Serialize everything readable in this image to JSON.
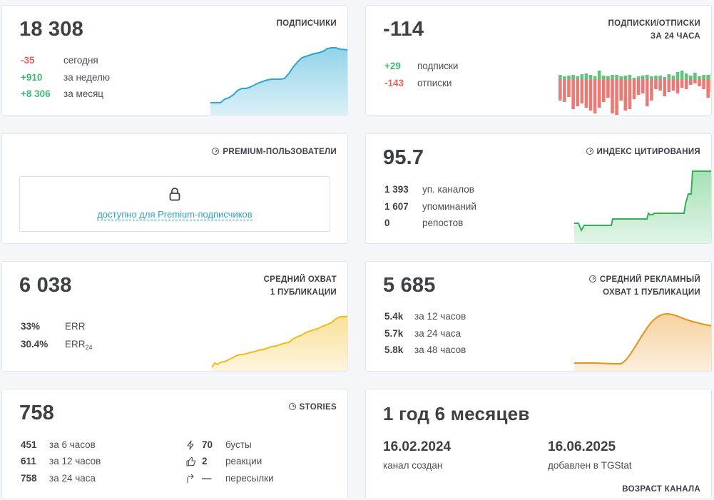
{
  "subscribers": {
    "value": "18 308",
    "title": "ПОДПИСЧИКИ",
    "rows": [
      {
        "value": "-35",
        "label": "сегодня"
      },
      {
        "value": "+910",
        "label": "за неделю"
      },
      {
        "value": "+8 306",
        "label": "за месяц"
      }
    ],
    "color": "#3bb0d6"
  },
  "subs_unsubs": {
    "value": "-114",
    "title": "ПОДПИСКИ/ОТПИСКИ",
    "title2": "ЗА 24 ЧАСА",
    "rows": [
      {
        "value": "+29",
        "label": "подписки"
      },
      {
        "value": "-143",
        "label": "отписки"
      }
    ],
    "pos_color": "#5ec57f",
    "neg_color": "#ea7a75"
  },
  "premium": {
    "title": "PREMIUM-ПОЛЬЗОВАТЕЛИ",
    "link": "доступно для Premium-подписчиков"
  },
  "citation": {
    "value": "95.7",
    "title": "ИНДЕКС ЦИТИРОВАНИЯ",
    "rows": [
      {
        "value": "1 393",
        "label": "уп. каналов"
      },
      {
        "value": "1 607",
        "label": "упоминаний"
      },
      {
        "value": "0",
        "label": "репостов"
      }
    ],
    "color": "#3cbb5e"
  },
  "reach": {
    "value": "6 038",
    "title": "СРЕДНИЙ ОХВАТ",
    "title2": "1 ПУБЛИКАЦИИ",
    "rows": [
      {
        "value": "33%",
        "label": "ERR"
      },
      {
        "value": "30.4%",
        "label": "ERR",
        "sub": "24"
      }
    ],
    "color": "#f2c230"
  },
  "ad_reach": {
    "value": "5 685",
    "title": "СРЕДНИЙ РЕКЛАМНЫЙ",
    "title2": "ОХВАТ 1 ПУБЛИКАЦИИ",
    "rows": [
      {
        "value": "5.4k",
        "label": "за 12 часов"
      },
      {
        "value": "5.7k",
        "label": "за 24 часа"
      },
      {
        "value": "5.8k",
        "label": "за 48 часов"
      }
    ],
    "color": "#eb9b2c"
  },
  "stories": {
    "value": "758",
    "title": "STORIES",
    "rows": [
      {
        "value": "451",
        "label": "за 6 часов"
      },
      {
        "value": "611",
        "label": "за 12 часов"
      },
      {
        "value": "758",
        "label": "за 24 часа"
      }
    ],
    "rows2": [
      {
        "icon": "lightning-icon",
        "value": "70",
        "label": "бусты"
      },
      {
        "icon": "thumbs-up-icon",
        "value": "2",
        "label": "реакции"
      },
      {
        "icon": "forward-arrow-icon",
        "value": "—",
        "label": "пересылки"
      }
    ]
  },
  "age": {
    "value": "1 год 6 месяцев",
    "date1": "16.02.2024",
    "label1": "канал создан",
    "date2": "16.06.2025",
    "label2": "добавлен в TGStat",
    "title": "ВОЗРАСТ КАНАЛА"
  }
}
